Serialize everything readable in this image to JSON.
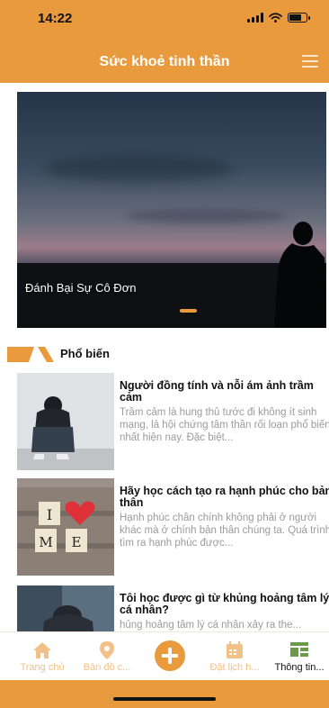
{
  "status_bar": {
    "time": "14:22"
  },
  "header": {
    "title": "Sức khoẻ tinh thần",
    "menu_icon": "hamburger-menu-icon"
  },
  "banner": {
    "caption": "Đánh Bại Sự Cô Đơn"
  },
  "section": {
    "title": "Phổ biến"
  },
  "articles": [
    {
      "title": "Người đồng tính và nỗi ám ảnh trầm cảm",
      "excerpt": "Trầm cảm là hung thủ tước đi không ít sinh mạng, là hội chứng tâm thần rối loạn phổ biến nhất hiện nay. Đặc biệt..."
    },
    {
      "title": "Hãy học cách tạo ra hạnh phúc cho bản thân",
      "excerpt": "Hạnh phúc chân chính không phải ở người khác mà ở chính bản thân chúng ta. Quá trình tìm ra hạnh phúc được..."
    },
    {
      "title": "Tôi học được gì từ khủng hoảng tâm lý cá nhân?",
      "excerpt": "hủng hoảng tâm lý cá nhân xảy ra the..."
    }
  ],
  "tabs": [
    {
      "label": "Trang chủ",
      "icon": "home-icon"
    },
    {
      "label": "Bản đồ c...",
      "icon": "map-pin-icon"
    },
    {
      "label": "",
      "icon": "plus-icon"
    },
    {
      "label": "Đặt lịch h...",
      "icon": "calendar-icon"
    },
    {
      "label": "Thông tin...",
      "icon": "info-layout-icon"
    }
  ],
  "colors": {
    "accent": "#e99a3c",
    "inactive_tab": "#f1c189"
  }
}
